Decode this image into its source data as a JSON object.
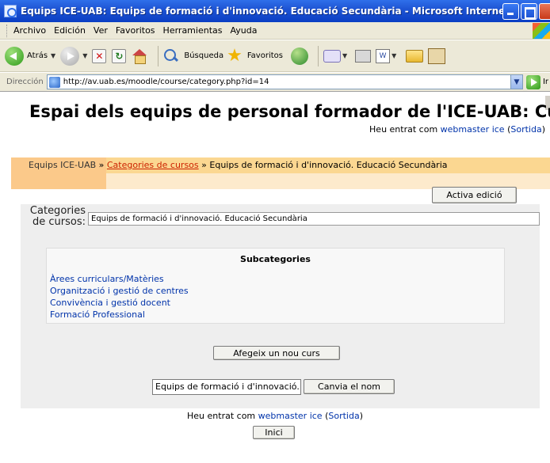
{
  "window": {
    "title": "Equips ICE-UAB: Equips de formació i d'innovació. Educació Secundària - Microsoft Internet Explorer"
  },
  "menubar": {
    "items": [
      "Archivo",
      "Edición",
      "Ver",
      "Favoritos",
      "Herramientas",
      "Ayuda"
    ]
  },
  "toolbar": {
    "back_label": "Atrás",
    "search_label": "Búsqueda",
    "favorites_label": "Favoritos"
  },
  "addressbar": {
    "label": "Dirección",
    "url": "http://av.uab.es/moodle/course/category.php?id=14",
    "go_label": "Ir"
  },
  "page": {
    "site_title": "Espai dels equips de personal formador de l'ICE-UAB: Cursos",
    "login_prefix": "Heu entrat com",
    "login_user": "webmaster ice",
    "logout_label": "Sortida",
    "breadcrumb": {
      "home": "Equips ICE-UAB",
      "sep": "»",
      "categories": "Categories de cursos",
      "current": "Equips de formació i d'innovació. Educació Secundària"
    },
    "edit_button": "Activa edició",
    "category_label_line1": "Categories",
    "category_label_line2": "de cursos:",
    "category_selected": "Equips de formació i d'innovació. Educació Secundària",
    "subcategories_heading": "Subcategories",
    "subcategories": [
      "Àrees curriculars/Matèries",
      "Organització i gestió de centres",
      "Convivència i gestió docent",
      "Formació Professional"
    ],
    "add_course_button": "Afegeix un nou curs",
    "rename_input_value": "Equips de formació i d'innovació.",
    "rename_button": "Canvia el nom",
    "home_button": "Inici"
  },
  "colors": {
    "nav_top": "#fbd791",
    "nav_bottom": "#fdeacc",
    "link": "#0033aa",
    "breadcrumb_link": "#cc2200"
  }
}
